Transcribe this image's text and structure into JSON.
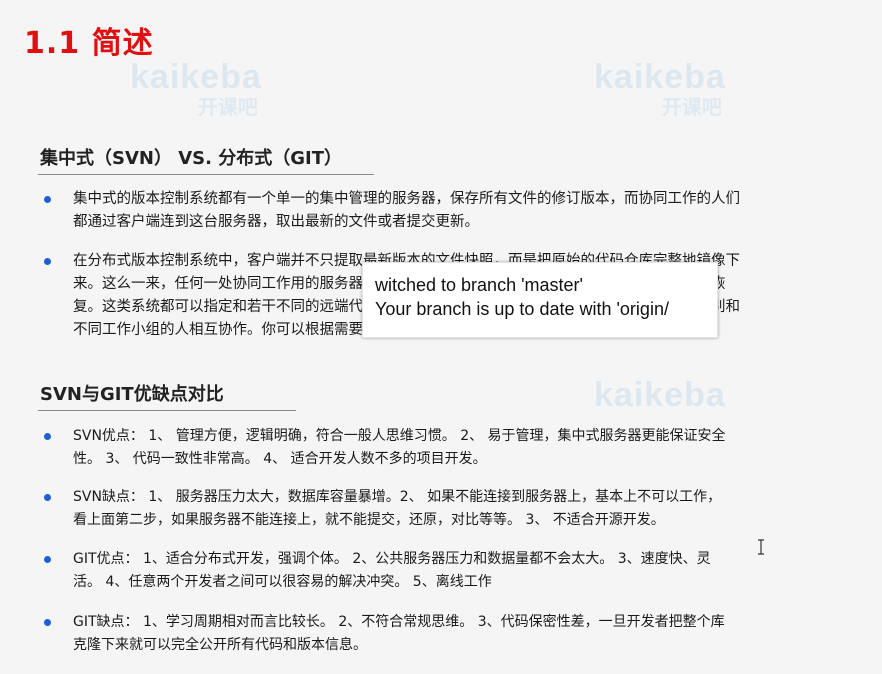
{
  "slide": {
    "title": "1.1 简述"
  },
  "watermark": {
    "brand": "kaikeba",
    "brand_cn": "开课吧"
  },
  "section1": {
    "heading": "集中式（SVN） VS. 分布式（GIT）",
    "bullets": [
      {
        "lines": [
          "集中式的版本控制系统都有一个单一的集中管理的服务器，保存所有文件的修订版本，而协同工作的人们",
          "都通过客户端连到这台服务器，取出最新的文件或者提交更新。"
        ]
      },
      {
        "lines": [
          "在分布式版本控制系统中，客户端并不只提取最新版本的文件快照，而是把原始的代码仓库完整地镜像下",
          "来。这么一来，任何一处协同工作用的服务器发生故障，事后都可以用任何一个镜像出来的本地仓库恢",
          "复。这类系统都可以指定和若干不同的远端代码仓库进行交互。籍此，你就可以在同一个项目中，分别和",
          "不同工作小组的人相互协作。你可以根据需要设定不同的协作流程。"
        ]
      }
    ]
  },
  "section2": {
    "heading": "SVN与GIT优缺点对比",
    "bullets": [
      {
        "lines": [
          "SVN优点： 1、 管理方便，逻辑明确，符合一般人思维习惯。 2、 易于管理，集中式服务器更能保证安全",
          "性。 3、 代码一致性非常高。 4、 适合开发人数不多的项目开发。"
        ]
      },
      {
        "lines": [
          "SVN缺点： 1、 服务器压力太大，数据库容量暴增。2、 如果不能连接到服务器上，基本上不可以工作，",
          "看上面第二步，如果服务器不能连接上，就不能提交，还原，对比等等。 3、 不适合开源开发。"
        ]
      },
      {
        "lines": [
          "GIT优点： 1、适合分布式开发，强调个体。 2、公共服务器压力和数据量都不会太大。 3、速度快、灵",
          "活。 4、任意两个开发者之间可以很容易的解决冲突。 5、离线工作"
        ]
      },
      {
        "lines": [
          "GIT缺点： 1、学习周期相对而言比较长。 2、不符合常规思维。 3、代码保密性差，一旦开发者把整个库",
          "克隆下来就可以完全公开所有代码和版本信息。"
        ]
      }
    ]
  },
  "terminal_overlay": {
    "line1": "witched to branch 'master'",
    "line2": "Your branch is up to date with 'origin/"
  },
  "icons": {
    "cursor": "text-cursor-icon",
    "bullet": "bullet-dot-icon"
  },
  "colors": {
    "title": "#e11010",
    "bullet": "#1f5fd6",
    "watermark": "#c9dced"
  }
}
